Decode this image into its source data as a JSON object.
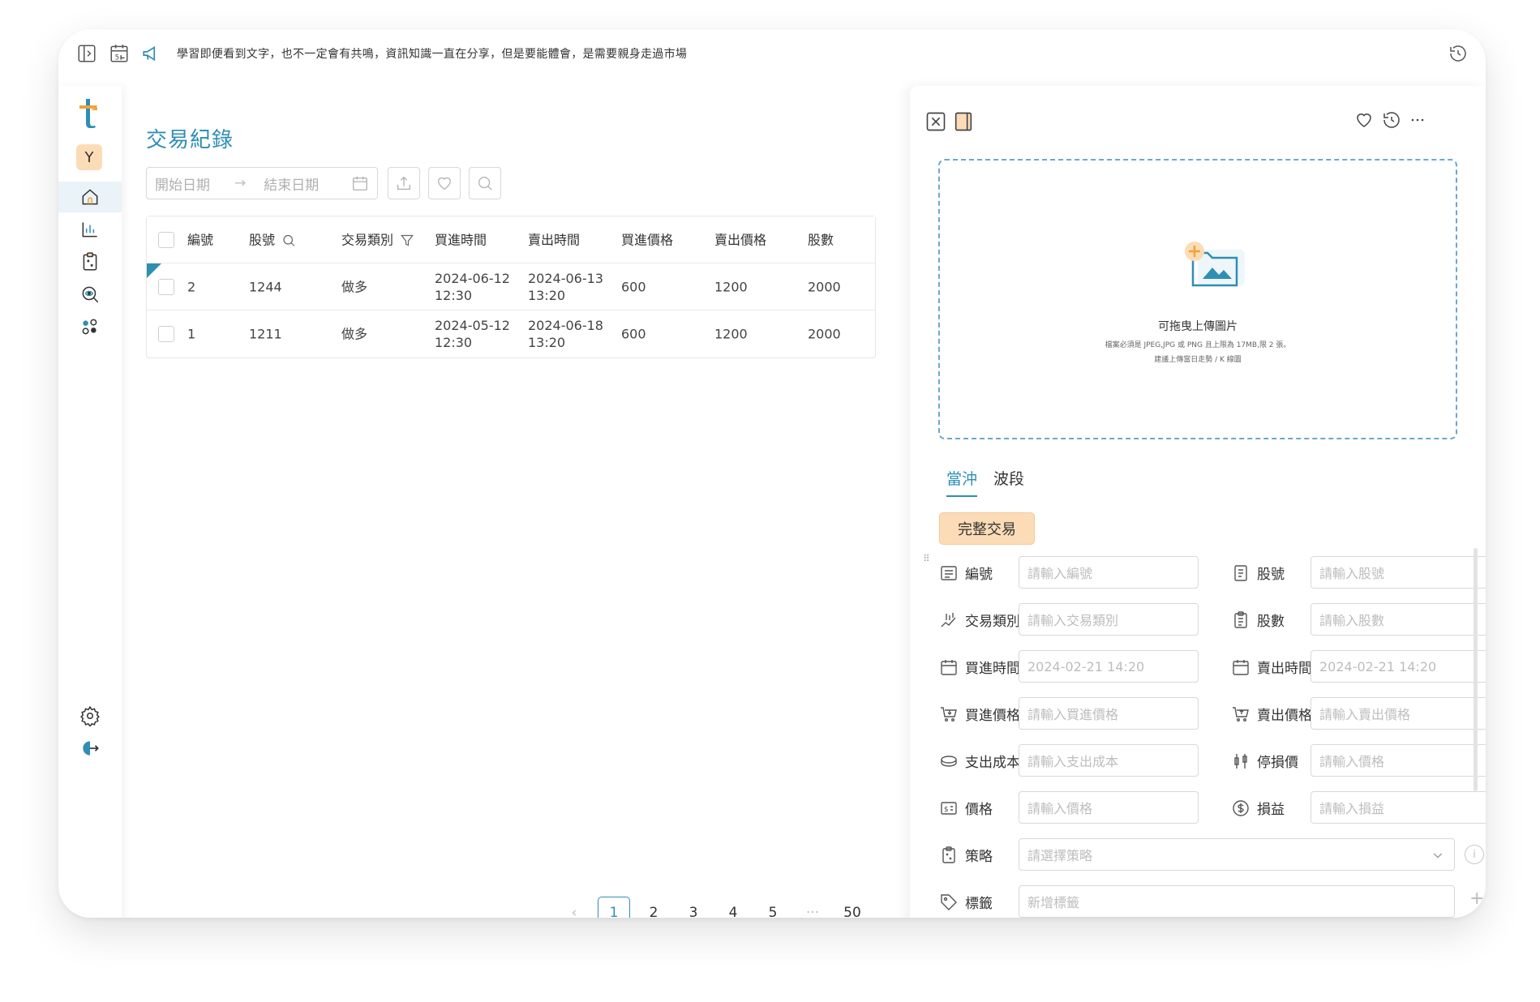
{
  "topbar": {
    "marquee": "學習即便看到文字，也不一定會有共鳴，資訊知識一直在分享，但是要能體會，是需要親身走過市場"
  },
  "sidebar": {
    "avatar": "Y",
    "items": [
      {
        "icon": "home-icon",
        "active": true
      },
      {
        "icon": "bar-chart-icon"
      },
      {
        "icon": "clipboard-icon"
      },
      {
        "icon": "eye-search-icon"
      },
      {
        "icon": "dots-cluster-icon"
      }
    ]
  },
  "main": {
    "title": "交易紀錄",
    "start_date_placeholder": "開始日期",
    "end_date_placeholder": "結束日期",
    "table": {
      "columns": [
        "編號",
        "股號",
        "交易類別",
        "買進時間",
        "賣出時間",
        "買進價格",
        "賣出價格",
        "股數"
      ],
      "rows": [
        {
          "id": "2",
          "stock": "1244",
          "type": "做多",
          "buy_date": "2024-06-12",
          "buy_time": "12:30",
          "sell_date": "2024-06-13",
          "sell_time": "13:20",
          "buy_price": "600",
          "sell_price": "1200",
          "shares": "2000"
        },
        {
          "id": "1",
          "stock": "1211",
          "type": "做多",
          "buy_date": "2024-05-12",
          "buy_time": "12:30",
          "sell_date": "2024-06-18",
          "sell_time": "13:20",
          "buy_price": "600",
          "sell_price": "1200",
          "shares": "2000"
        }
      ]
    },
    "pager": {
      "pages": [
        "1",
        "2",
        "3",
        "4",
        "5"
      ],
      "ellipsis": "···",
      "last": "50",
      "current": "1"
    }
  },
  "panel": {
    "upload": {
      "title": "可拖曳上傳圖片",
      "note1": "檔案必須是 JPEG,JPG 或 PNG 且上限為 17MB,限 2 張。",
      "note2": "建議上傳當日走勢 / K 線圖"
    },
    "tabs": [
      "當沖",
      "波段"
    ],
    "full_trade": "完整交易",
    "fields": {
      "id": {
        "label": "編號",
        "placeholder": "請輸入編號"
      },
      "stock": {
        "label": "股號",
        "placeholder": "請輸入股號"
      },
      "type": {
        "label": "交易類別",
        "placeholder": "請輸入交易類別"
      },
      "shares": {
        "label": "股數",
        "placeholder": "請輸入股數"
      },
      "buy_time": {
        "label": "買進時間",
        "placeholder": "2024-02-21 14:20"
      },
      "sell_time": {
        "label": "賣出時間",
        "placeholder": "2024-02-21 14:20"
      },
      "buy_price": {
        "label": "買進價格",
        "placeholder": "請輸入買進價格"
      },
      "sell_price": {
        "label": "賣出價格",
        "placeholder": "請輸入賣出價格"
      },
      "cost": {
        "label": "支出成本",
        "placeholder": "請輸入支出成本"
      },
      "stop": {
        "label": "停損價",
        "placeholder": "請輸入價格"
      },
      "price": {
        "label": "價格",
        "placeholder": "請輸入價格"
      },
      "pnl": {
        "label": "損益",
        "placeholder": "請輸入損益"
      },
      "strategy": {
        "label": "策略",
        "placeholder": "請選擇策略"
      },
      "tags": {
        "label": "標籤",
        "placeholder": "新增標籤"
      }
    }
  },
  "colors": {
    "accent": "#2f8eb4",
    "peach": "#fcdcb7",
    "logo_orange": "#f2a23a"
  }
}
